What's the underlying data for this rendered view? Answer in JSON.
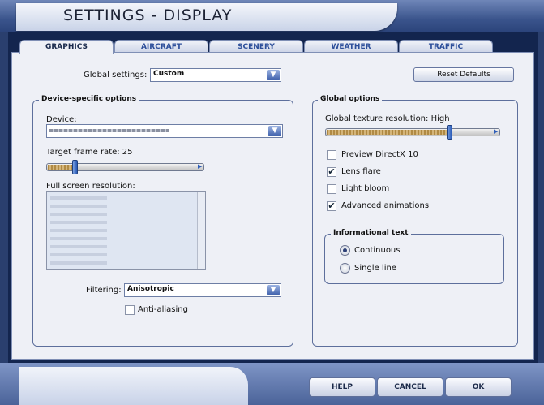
{
  "window": {
    "title": "SETTINGS - DISPLAY"
  },
  "tabs": [
    {
      "label": "GRAPHICS",
      "active": true
    },
    {
      "label": "AIRCRAFT",
      "active": false
    },
    {
      "label": "SCENERY",
      "active": false
    },
    {
      "label": "WEATHER",
      "active": false
    },
    {
      "label": "TRAFFIC",
      "active": false
    }
  ],
  "global": {
    "label": "Global settings:",
    "value": "Custom",
    "reset_label": "Reset Defaults"
  },
  "device_group": {
    "title": "Device-specific options",
    "device_label": "Device:",
    "target_label": "Target frame rate: 25",
    "target_level_fraction": 0.17,
    "fullscreen_label": "Full screen resolution:",
    "filtering_label": "Filtering:",
    "filtering_value": "Anisotropic",
    "antialiasing_label": "Anti-aliasing",
    "antialiasing_checked": false
  },
  "global_options": {
    "title": "Global options",
    "texture_label": "Global texture resolution: High",
    "texture_level_fraction": 0.74,
    "checkboxes": [
      {
        "label": "Preview DirectX 10",
        "checked": false
      },
      {
        "label": "Lens flare",
        "checked": true
      },
      {
        "label": "Light bloom",
        "checked": false
      },
      {
        "label": "Advanced animations",
        "checked": true
      }
    ],
    "info_title": "Informational text",
    "radios": [
      {
        "label": "Continuous",
        "selected": true
      },
      {
        "label": "Single line",
        "selected": false
      }
    ]
  },
  "footer": {
    "help": "HELP",
    "cancel": "CANCEL",
    "ok": "OK"
  },
  "icons": {
    "dropdown": "chevron-down-icon",
    "check": "checkmark-icon"
  }
}
